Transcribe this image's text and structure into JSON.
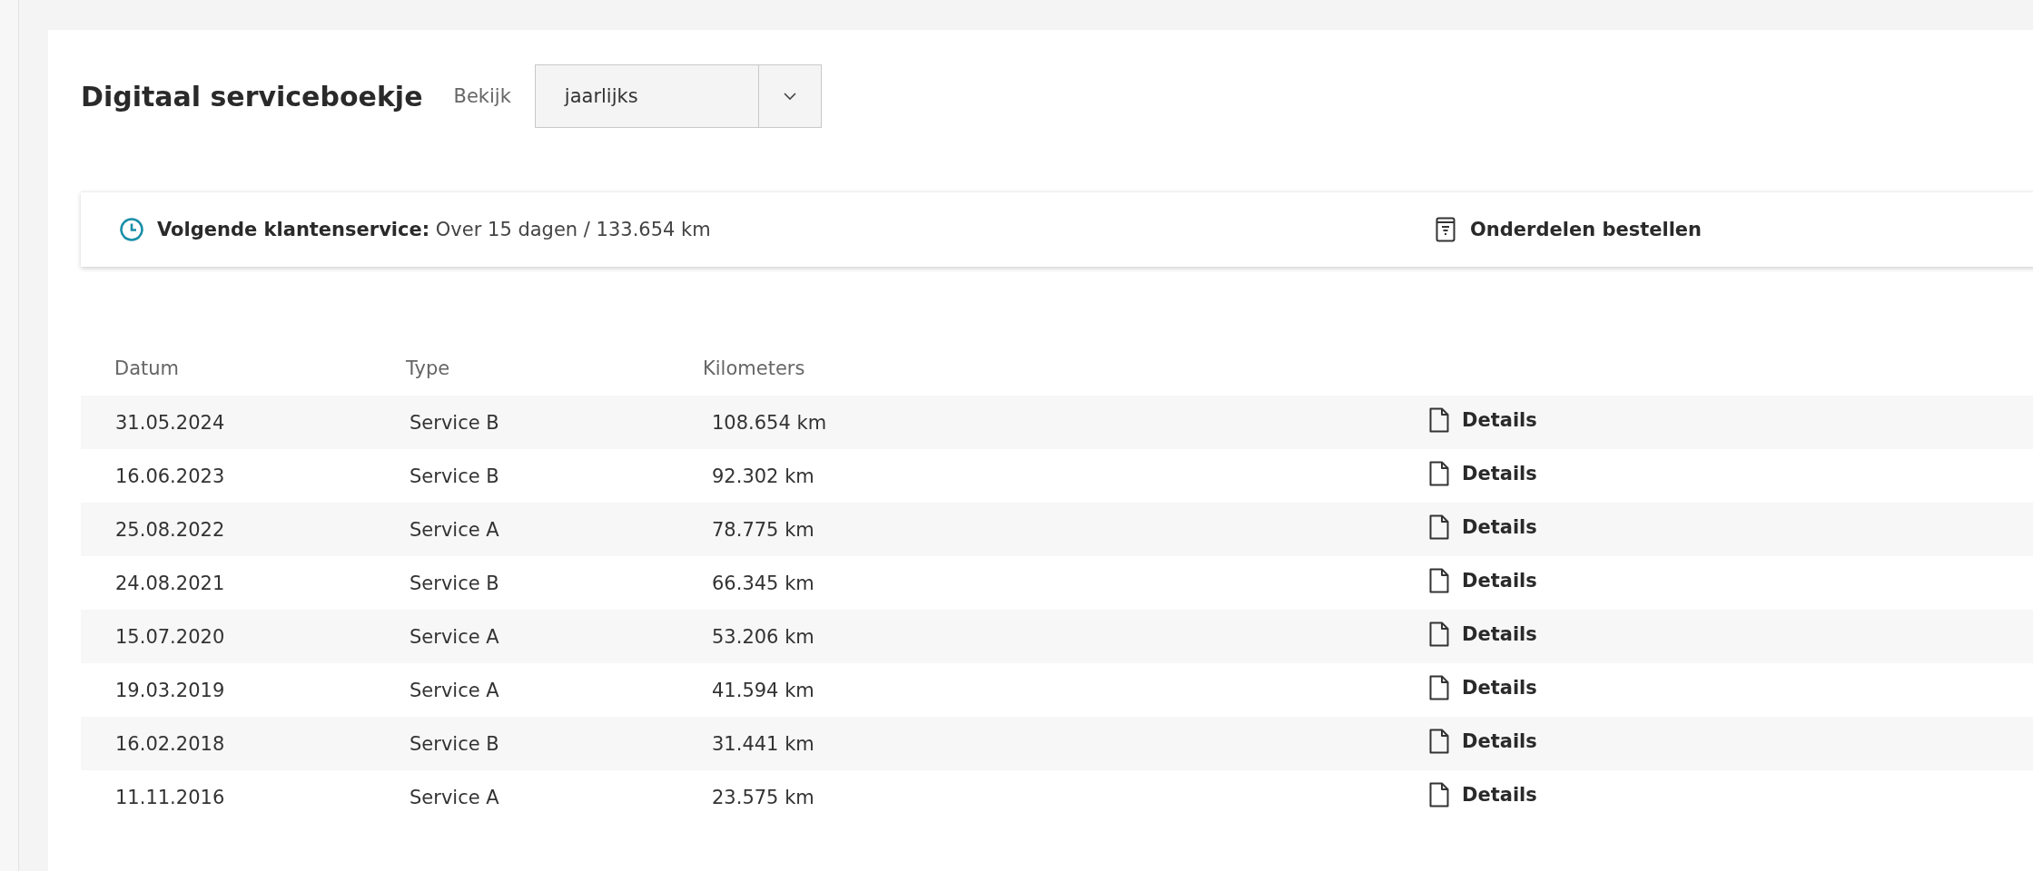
{
  "title": "Digitaal serviceboekje",
  "view": {
    "label": "Bekijk",
    "value": "jaarlijks"
  },
  "next_service": {
    "label": "Volgende klantenservice:",
    "value": "Over 15 dagen / 133.654 km"
  },
  "order_parts": {
    "label": "Onderdelen bestellen"
  },
  "table": {
    "columns": [
      "Datum",
      "Type",
      "Kilometers"
    ],
    "rows": [
      {
        "date": "31.05.2024",
        "type": "Service B",
        "km": "108.654 km",
        "action": "Details"
      },
      {
        "date": "16.06.2023",
        "type": "Service B",
        "km": "92.302 km",
        "action": "Details"
      },
      {
        "date": "25.08.2022",
        "type": "Service A",
        "km": "78.775 km",
        "action": "Details"
      },
      {
        "date": "24.08.2021",
        "type": "Service B",
        "km": "66.345 km",
        "action": "Details"
      },
      {
        "date": "15.07.2020",
        "type": "Service A",
        "km": "53.206 km",
        "action": "Details"
      },
      {
        "date": "19.03.2019",
        "type": "Service A",
        "km": "41.594 km",
        "action": "Details"
      },
      {
        "date": "16.02.2018",
        "type": "Service B",
        "km": "31.441 km",
        "action": "Details"
      },
      {
        "date": "11.11.2016",
        "type": "Service A",
        "km": "23.575 km",
        "action": "Details"
      }
    ]
  }
}
